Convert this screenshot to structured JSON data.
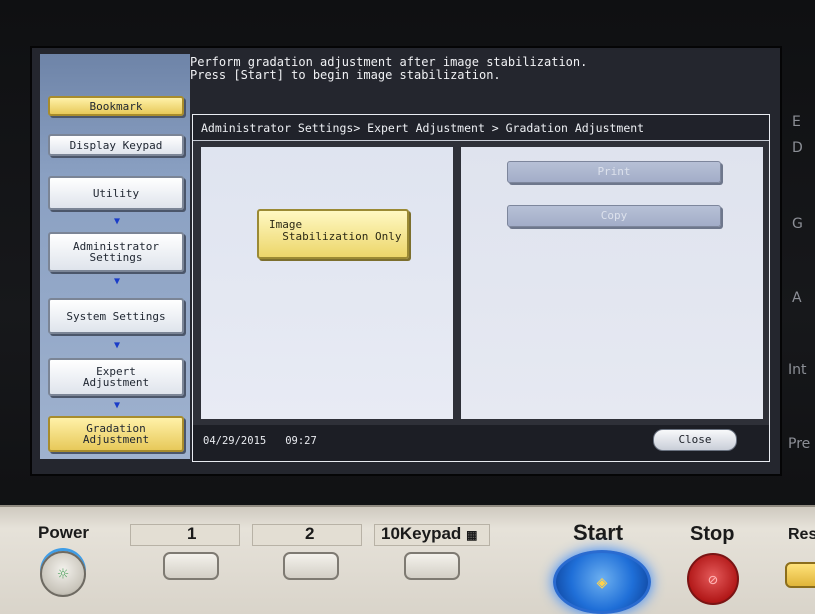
{
  "message": {
    "line1": "Perform gradation adjustment after image stabilization.",
    "line2": "Press [Start] to begin image stabilization."
  },
  "left_nav": {
    "bookmark": "Bookmark",
    "display_keypad": "Display Keypad",
    "items": [
      {
        "label": "Utility"
      },
      {
        "label": "Administrator\nSettings"
      },
      {
        "label": "System Settings"
      },
      {
        "label": "Expert\nAdjustment"
      },
      {
        "label": "Gradation\nAdjustment"
      }
    ]
  },
  "breadcrumb": "Administrator Settings> Expert Adjustment > Gradation Adjustment",
  "main": {
    "image_stabilization_label": "Image\n  Stabilization Only",
    "print_label": "Print",
    "copy_label": "Copy"
  },
  "status": {
    "date": "04/29/2015",
    "time": "09:27",
    "close_label": "Close"
  },
  "right_edge": {
    "fragments": [
      "E",
      "D",
      "G",
      "A",
      "Int",
      "Pre"
    ]
  },
  "hardware": {
    "power_label": "Power",
    "key1_label": "1",
    "key2_label": "2",
    "keypad_label": "10Keypad",
    "start_label": "Start",
    "stop_label": "Stop",
    "reset_label": "Res"
  },
  "colors": {
    "accent_gold": "#ecd66a",
    "screen_bg": "#24262e",
    "start_blue": "#1f6fd8",
    "stop_red": "#b21818"
  }
}
